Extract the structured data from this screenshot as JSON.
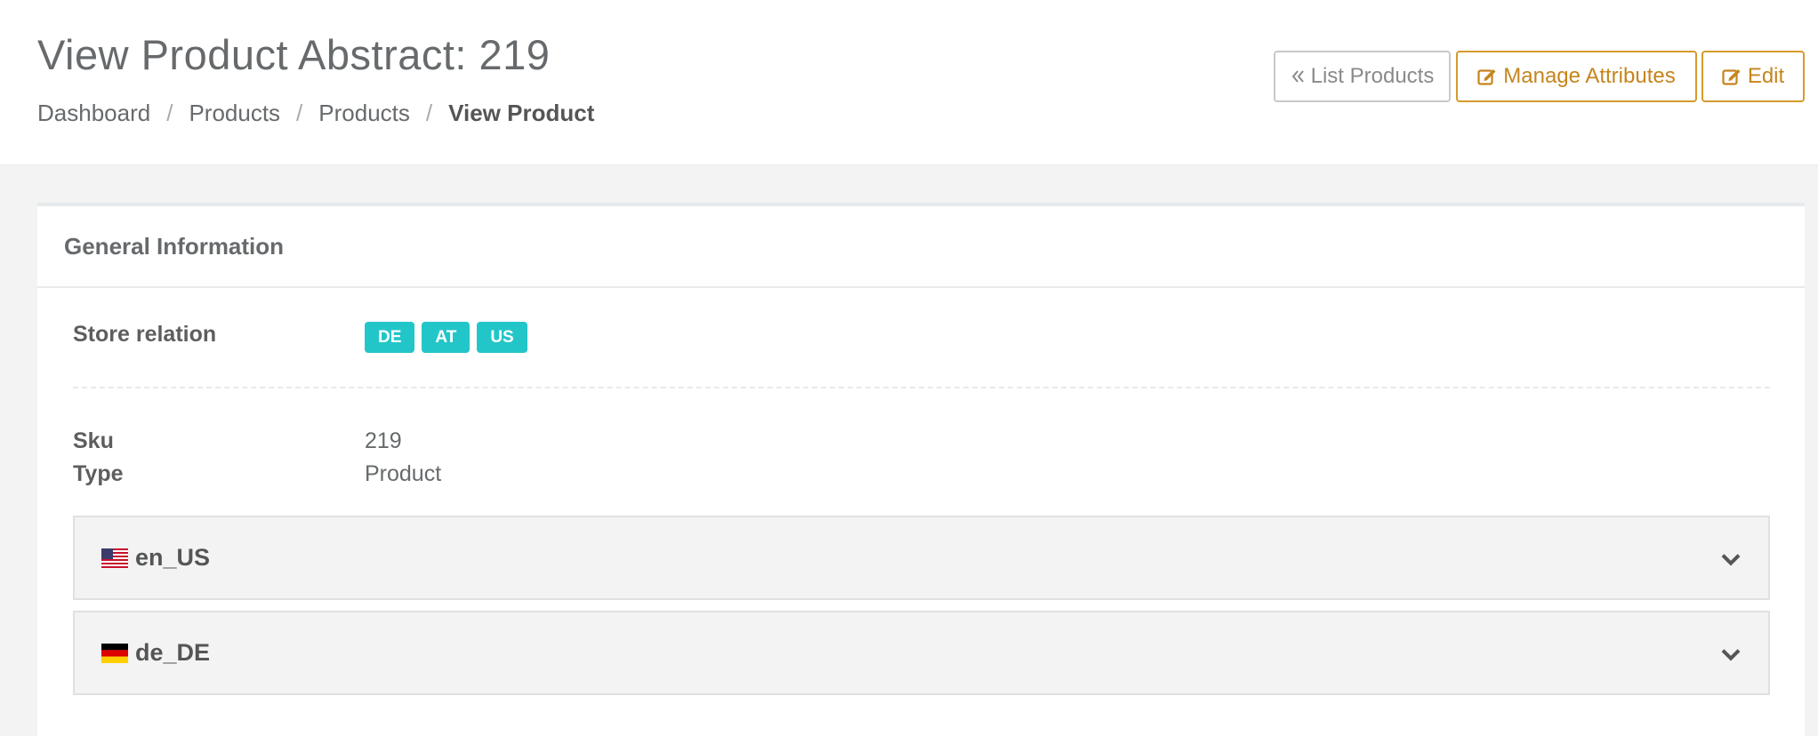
{
  "header": {
    "title": "View Product Abstract: 219",
    "breadcrumb": [
      "Dashboard",
      "Products",
      "Products",
      "View Product"
    ],
    "breadcrumb_separator": "/",
    "buttons": {
      "list_products": "List Products",
      "manage_attributes": "Manage Attributes",
      "edit": "Edit"
    }
  },
  "general_info": {
    "title": "General Information",
    "store_relation_label": "Store relation",
    "stores": [
      "DE",
      "AT",
      "US"
    ],
    "sku_label": "Sku",
    "sku_value": "219",
    "type_label": "Type",
    "type_value": "Product"
  },
  "locales": [
    {
      "code": "en_US",
      "flag": "us-flag-icon"
    },
    {
      "code": "de_DE",
      "flag": "de-flag-icon"
    }
  ],
  "colors": {
    "accent_warning": "#c6851c",
    "badge": "#23c6c8",
    "text": "#676a6c"
  }
}
